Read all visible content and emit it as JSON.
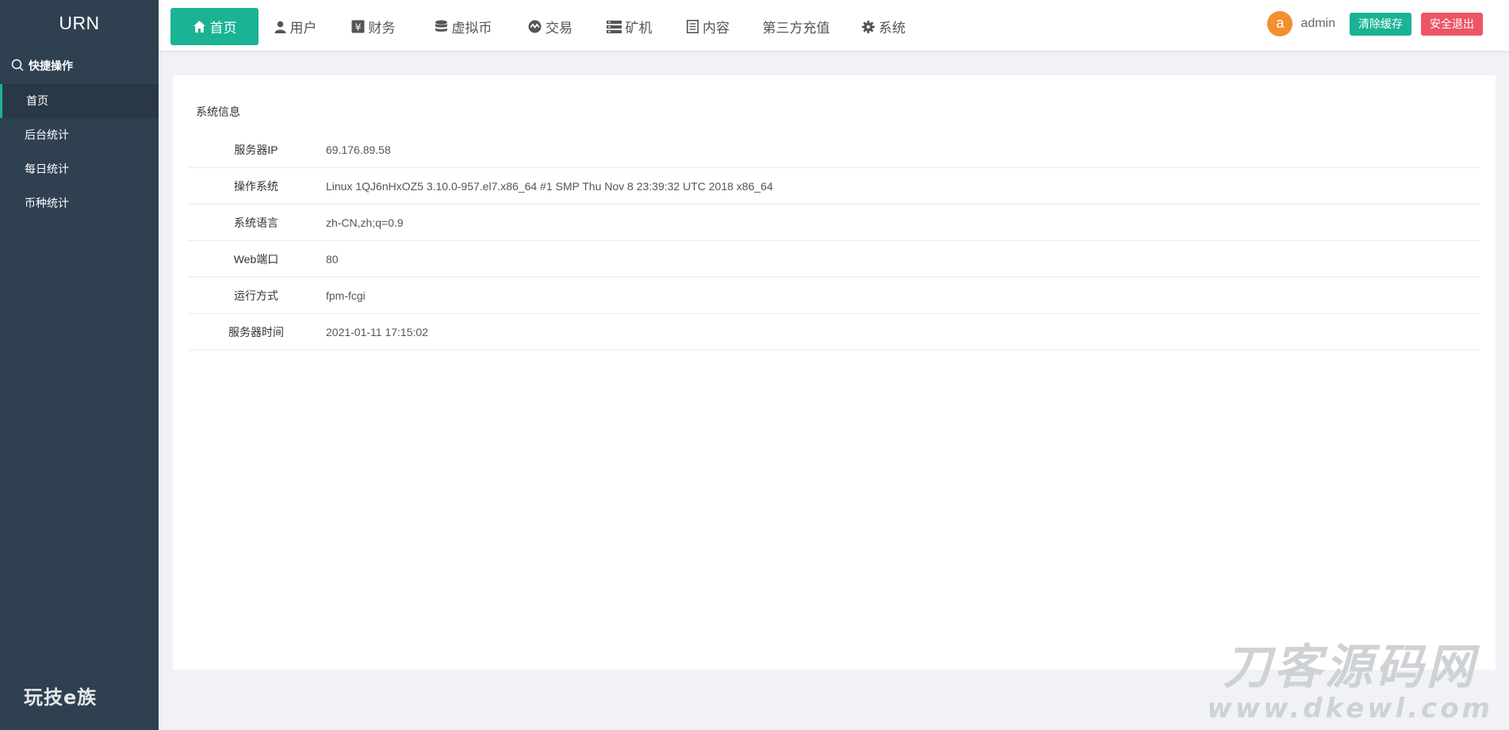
{
  "sidebar": {
    "app_title": "URN",
    "quick_label": "快捷操作",
    "items": [
      {
        "label": "首页",
        "active": true
      },
      {
        "label": "后台统计",
        "active": false
      },
      {
        "label": "每日统计",
        "active": false
      },
      {
        "label": "币种统计",
        "active": false
      }
    ],
    "brand": "玩技e族"
  },
  "topnav": {
    "items": [
      {
        "label": "首页",
        "icon": "home-icon",
        "active": true
      },
      {
        "label": "用户",
        "icon": "user-icon",
        "active": false
      },
      {
        "label": "财务",
        "icon": "yen-icon",
        "active": false
      },
      {
        "label": "虚拟币",
        "icon": "database-icon",
        "active": false
      },
      {
        "label": "交易",
        "icon": "exchange-icon",
        "active": false
      },
      {
        "label": "矿机",
        "icon": "server-icon",
        "active": false
      },
      {
        "label": "内容",
        "icon": "document-icon",
        "active": false
      },
      {
        "label": "第三方充值",
        "icon": "",
        "active": false
      },
      {
        "label": "系统",
        "icon": "gear-icon",
        "active": false
      }
    ]
  },
  "user": {
    "avatar_letter": "a",
    "name": "admin",
    "clear_cache": "清除缓存",
    "logout": "安全退出"
  },
  "system_info": {
    "title": "系统信息",
    "rows": [
      {
        "label": "服务器IP",
        "value": "69.176.89.58"
      },
      {
        "label": "操作系统",
        "value": "Linux 1QJ6nHxOZ5 3.10.0-957.el7.x86_64 #1 SMP Thu Nov 8 23:39:32 UTC 2018 x86_64"
      },
      {
        "label": "系统语言",
        "value": "zh-CN,zh;q=0.9"
      },
      {
        "label": "Web端口",
        "value": "80"
      },
      {
        "label": "运行方式",
        "value": "fpm-fcgi"
      },
      {
        "label": "服务器时间",
        "value": "2021-01-11 17:15:02"
      }
    ]
  },
  "watermark": {
    "main": "刀客源码网",
    "url": "www.dkewl.com"
  },
  "colors": {
    "sidebar_bg": "#2f4050",
    "accent": "#1ab394",
    "danger": "#ed5565",
    "avatar": "#f0902e"
  }
}
